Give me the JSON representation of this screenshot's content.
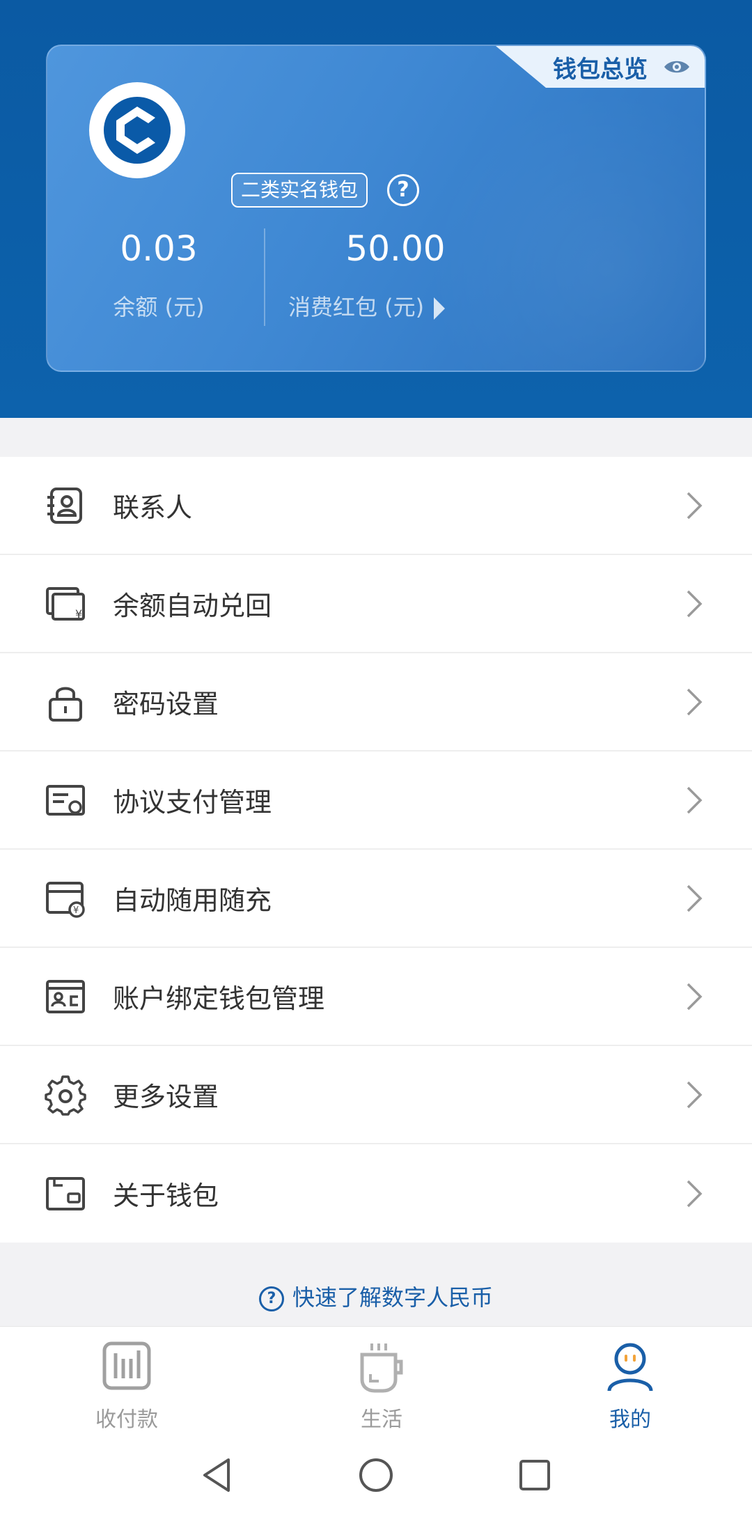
{
  "card": {
    "overview_label": "钱包总览",
    "wallet_type_badge": "二类实名钱包",
    "help_symbol": "?",
    "balance_amount": "0.03",
    "balance_label": "余额 (元)",
    "redpacket_amount": "50.00",
    "redpacket_label": "消费红包 (元)"
  },
  "menu": {
    "items": [
      {
        "label": "联系人",
        "icon": "contacts-icon"
      },
      {
        "label": "余额自动兑回",
        "icon": "auto-redeem-icon"
      },
      {
        "label": "密码设置",
        "icon": "lock-icon"
      },
      {
        "label": "协议支付管理",
        "icon": "agreement-payment-icon"
      },
      {
        "label": "自动随用随充",
        "icon": "auto-topup-icon"
      },
      {
        "label": "账户绑定钱包管理",
        "icon": "id-card-icon"
      },
      {
        "label": "更多设置",
        "icon": "gear-icon"
      },
      {
        "label": "关于钱包",
        "icon": "wallet-icon"
      }
    ]
  },
  "quick_help": {
    "label": "快速了解数字人民币",
    "symbol": "?"
  },
  "bottom_nav": {
    "items": [
      {
        "label": "收付款",
        "icon": "payment-icon",
        "active": false
      },
      {
        "label": "生活",
        "icon": "coffee-cup-icon",
        "active": false
      },
      {
        "label": "我的",
        "icon": "profile-icon",
        "active": true
      }
    ]
  },
  "colors": {
    "header_blue": "#0b5aa3",
    "accent_blue": "#1a5fa8",
    "inactive_gray": "#9a9a9a"
  }
}
